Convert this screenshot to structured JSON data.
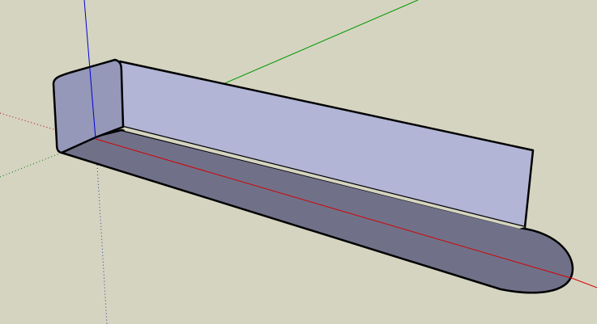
{
  "scene": {
    "background_color": "#d5d4c1",
    "axes": {
      "red_axis_color": "#d40000",
      "green_axis_color": "#009a00",
      "blue_axis_color": "#0000d4"
    },
    "model": {
      "front_face_color": "#b2b5d6",
      "side_face_color": "#9598b8",
      "shadow_face_color": "#707189",
      "edge_color": "#000000"
    }
  }
}
